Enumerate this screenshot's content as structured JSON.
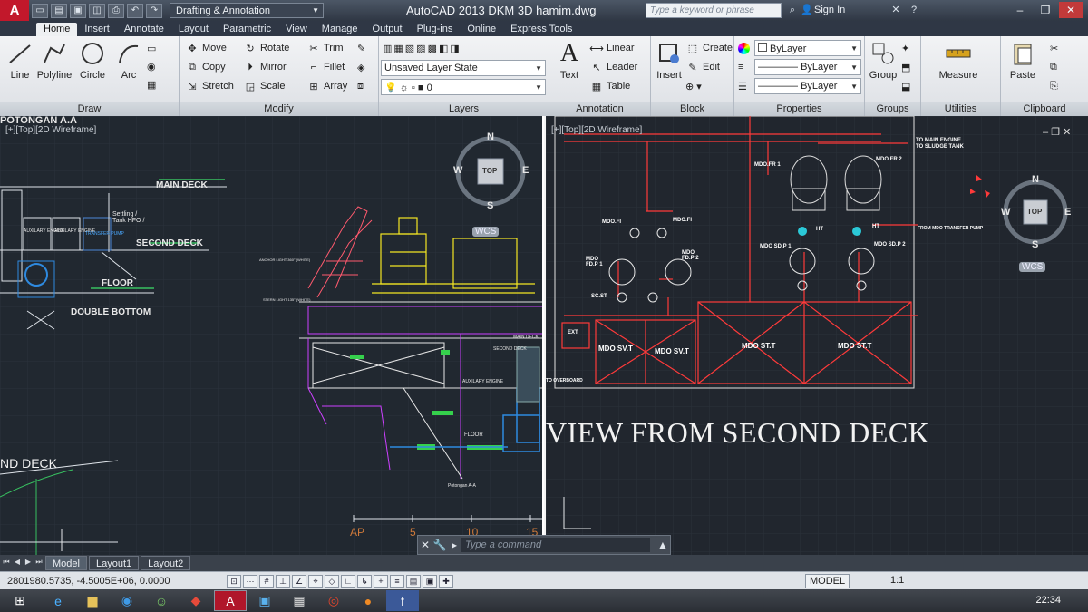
{
  "titlebar": {
    "logo": "A",
    "workspace": "Drafting & Annotation",
    "app_title": "AutoCAD 2013    DKM 3D hamim.dwg",
    "search_placeholder": "Type a keyword or phrase",
    "sign_in": "Sign In"
  },
  "tabs": [
    "Home",
    "Insert",
    "Annotate",
    "Layout",
    "Parametric",
    "View",
    "Manage",
    "Output",
    "Plug-ins",
    "Online",
    "Express Tools"
  ],
  "ribbon": {
    "draw": {
      "title": "Draw",
      "line": "Line",
      "polyline": "Polyline",
      "circle": "Circle",
      "arc": "Arc"
    },
    "modify": {
      "title": "Modify",
      "move": "Move",
      "rotate": "Rotate",
      "trim": "Trim",
      "copy": "Copy",
      "mirror": "Mirror",
      "fillet": "Fillet",
      "stretch": "Stretch",
      "scale": "Scale",
      "array": "Array"
    },
    "layers": {
      "title": "Layers",
      "layer_state": "Unsaved Layer State",
      "current_layer": "0"
    },
    "annotation": {
      "title": "Annotation",
      "text": "Text",
      "linear": "Linear",
      "leader": "Leader",
      "table": "Table"
    },
    "block": {
      "title": "Block",
      "insert": "Insert",
      "create": "Create",
      "edit": "Edit"
    },
    "properties": {
      "title": "Properties",
      "color": "ByLayer",
      "linetype": "ByLayer",
      "lineweight": "ByLayer"
    },
    "groups": {
      "title": "Groups",
      "group": "Group"
    },
    "utilities": {
      "title": "Utilities",
      "measure": "Measure"
    },
    "clipboard": {
      "title": "Clipboard",
      "paste": "Paste"
    }
  },
  "left_viewport": {
    "label": "[+][Top][2D Wireframe]",
    "section_title": "POTONGAN A.A",
    "main_deck": "MAIN DECK",
    "second_deck": "SECOND DECK",
    "floor": "FLOOR",
    "double_bottom": "DOUBLE BOTTOM",
    "settling_tank": "Settling / Tank HFO /",
    "auxiliary_engine_1": "AUXILARY ENGINE",
    "auxiliary_engine_2": "AUXILARY ENGINE",
    "transfer_pump": "TRANSFER PUMP",
    "anchor_light": "ANCHOR LIGHT 360° (WHITE)",
    "stern_light": "STERN LIGHT 135° (WHITE)",
    "main_deck_small": "MAIN DECK",
    "second_deck_small": "SECOND DECK",
    "aux_engine_small": "AUXILARY ENGINE",
    "floor_small": "FLOOR",
    "potongan_small": "Potongan A-A",
    "and_deck": "ND DECK",
    "wcs": "WCS",
    "compass": {
      "n": "N",
      "s": "S",
      "e": "E",
      "w": "W",
      "top": "TOP"
    },
    "ruler": [
      "AP",
      "5",
      "10",
      "15"
    ]
  },
  "right_viewport": {
    "label": "[+][Top][2D Wireframe]",
    "view_title": "VIEW FROM SECOND DECK",
    "to_main_engine": "TO MAIN ENGINE",
    "to_sludge_tank": "TO SLUDGE TANK",
    "from_mdo_transfer": "FROM MDO TRANSFER PUMP",
    "mdo_fr1": "MDO.FR 1",
    "mdo_fr2": "MDO.FR 2",
    "mdo_fi_1": "MDO.FI",
    "mdo_fi_2": "MDO.FI",
    "mdo_fdp1": "MDO FD.P 1",
    "mdo_fdp2": "MDO FD.P 2",
    "mdo_sdp1": "MDO SD.P 1",
    "mdo_sdp2": "MDO SD.P 2",
    "ht1": "HT",
    "ht2": "HT",
    "sc_st": "SC.ST",
    "ext": "EXT",
    "tank_1": "MDO SV.T",
    "tank_2": "MDO SV.T",
    "tank_3": "MDO ST.T",
    "tank_4": "MDO ST.T",
    "overboard": "TO OVERBOARD",
    "wcs": "WCS",
    "compass": {
      "n": "N",
      "s": "S",
      "e": "E",
      "w": "W",
      "top": "TOP"
    }
  },
  "command_line": {
    "placeholder": "Type a command"
  },
  "layout_tabs": [
    "Model",
    "Layout1",
    "Layout2"
  ],
  "statusbar": {
    "coords": "2801980.5735, -4.5005E+06, 0.0000",
    "model": "MODEL",
    "anno_scale": "1:1"
  },
  "taskbar": {
    "clock": "22:34"
  }
}
